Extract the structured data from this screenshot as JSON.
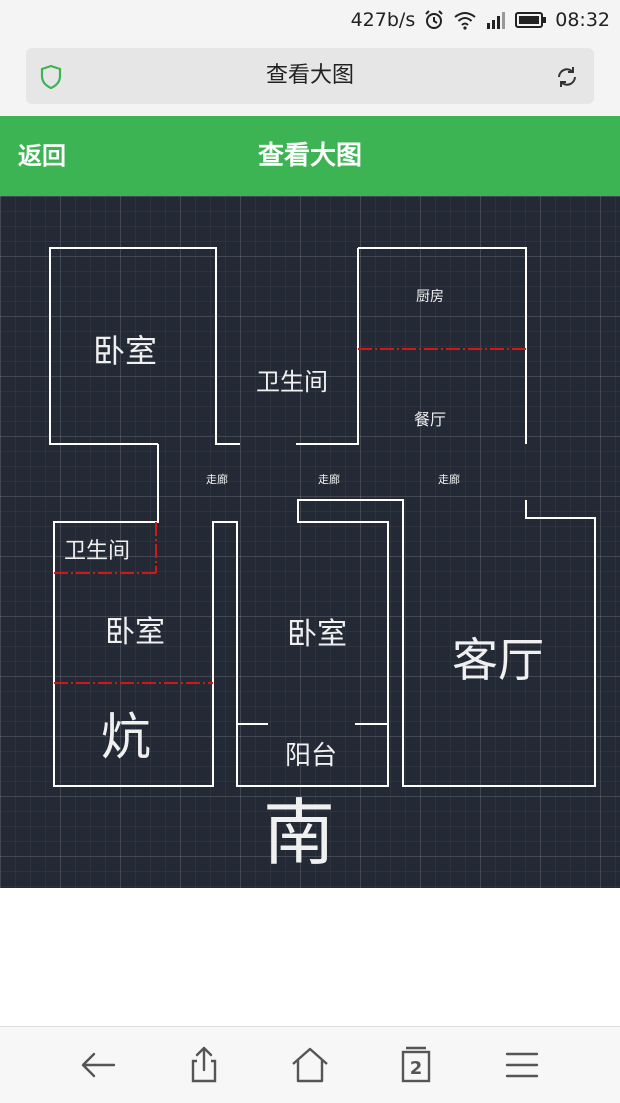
{
  "status_bar": {
    "speed": "427b/s",
    "time": "08:32"
  },
  "address_bar": {
    "title": "查看大图"
  },
  "header": {
    "back_label": "返回",
    "title": "查看大图"
  },
  "floor_plan": {
    "rooms": {
      "bedroom_top_left": "卧室",
      "bathroom_top": "卫生间",
      "kitchen": "厨房",
      "dining": "餐厅",
      "corridor_1": "走廊",
      "corridor_2": "走廊",
      "corridor_3": "走廊",
      "bathroom_left": "卫生间",
      "bedroom_left": "卧室",
      "kang": "炕",
      "bedroom_center": "卧室",
      "balcony": "阳台",
      "living_room": "客厅"
    },
    "direction": "南",
    "colors": {
      "background": "#242a35",
      "wall": "#ffffff",
      "partition": "#d01818"
    }
  },
  "toolbar": {
    "tab_count": "2",
    "icons": [
      "back-arrow-icon",
      "share-icon",
      "home-icon",
      "tabs-icon",
      "menu-icon"
    ]
  },
  "colors": {
    "accent": "#3cb454"
  }
}
